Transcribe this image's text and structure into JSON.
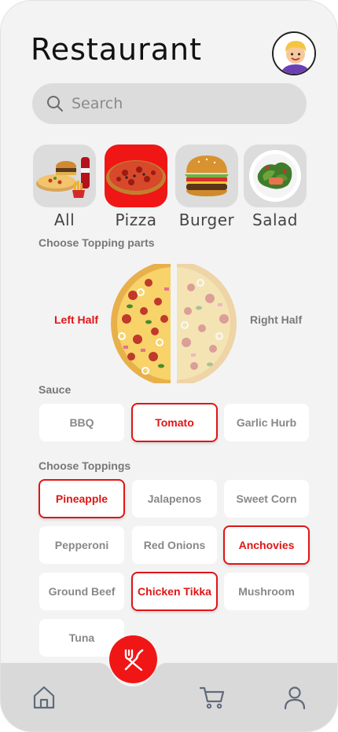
{
  "header": {
    "title": "Restaurant"
  },
  "search": {
    "placeholder": "Search"
  },
  "categories": [
    {
      "label": "All",
      "active": false
    },
    {
      "label": "Pizza",
      "active": true
    },
    {
      "label": "Burger",
      "active": false
    },
    {
      "label": "Salad",
      "active": false
    }
  ],
  "topping_parts": {
    "label": "Choose Topping parts",
    "left": "Left Half",
    "right": "Right Half",
    "selected": "Left Half"
  },
  "sauce": {
    "label": "Sauce",
    "options": [
      "BBQ",
      "Tomato",
      "Garlic Hurb"
    ],
    "selected": "Tomato"
  },
  "toppings": {
    "label": "Choose Toppings",
    "options": [
      "Pineapple",
      "Jalapenos",
      "Sweet Corn",
      "Pepperoni",
      "Red Onions",
      "Anchovies",
      "Ground Beef",
      "Chicken Tikka",
      "Mushroom",
      "Tuna"
    ],
    "selected": [
      "Pineapple",
      "Anchovies",
      "Chicken Tikka"
    ]
  },
  "colors": {
    "accent": "#f01616",
    "background": "#f3f3f3",
    "tile": "#dcdcdc"
  },
  "nav": {
    "items": [
      "home-icon",
      "cutlery-icon",
      "cart-icon",
      "user-icon"
    ]
  }
}
